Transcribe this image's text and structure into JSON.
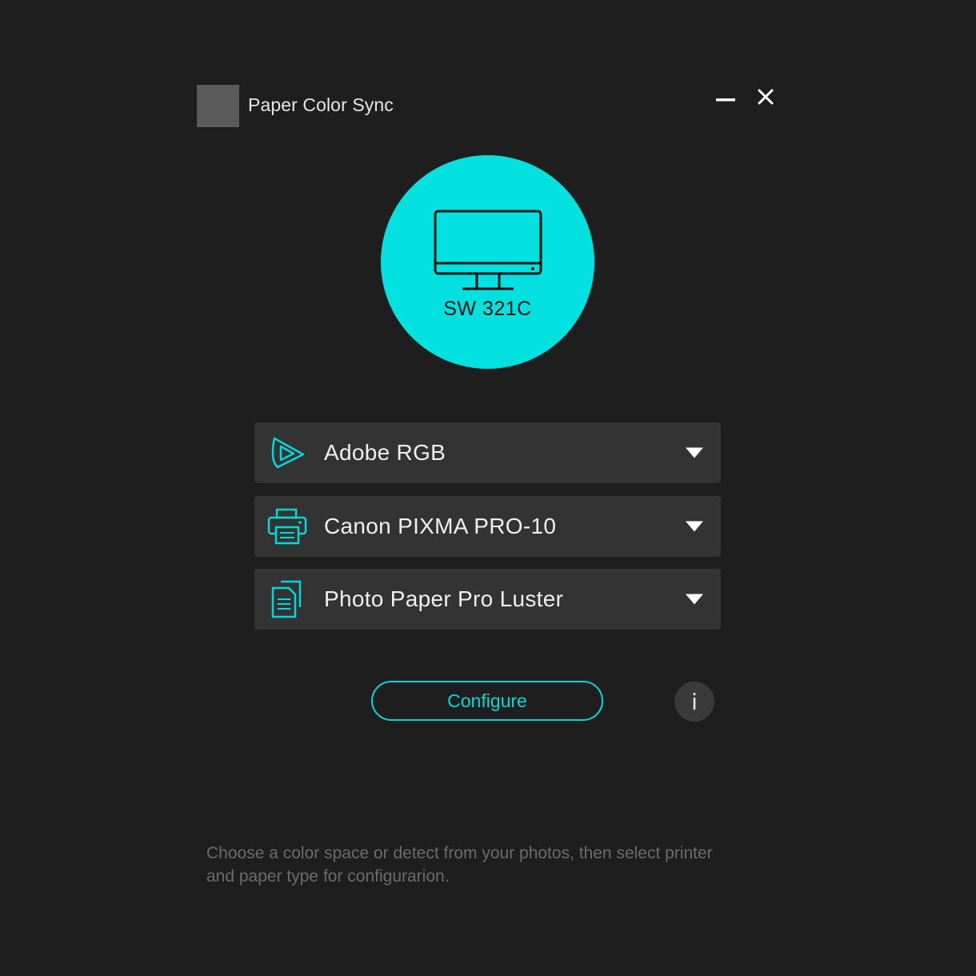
{
  "window": {
    "title": "Paper Color Sync",
    "app_icon": "app-logo-placeholder",
    "minimize_icon": "minimize-icon",
    "close_icon": "close-icon"
  },
  "device": {
    "name": "SW 321C",
    "icon": "monitor-icon",
    "circle_color": "#03e0e0"
  },
  "dropdowns": {
    "color_space": {
      "label": "Adobe RGB",
      "icon": "color-space-play-icon"
    },
    "printer": {
      "label": "Canon PIXMA PRO-10",
      "icon": "printer-icon"
    },
    "paper": {
      "label": "Photo Paper Pro Luster",
      "icon": "paper-documents-icon"
    }
  },
  "actions": {
    "configure_label": "Configure",
    "info_label": "i"
  },
  "hint": "Choose a color space or detect from your photos, then select printer and paper type for configurarion.",
  "colors": {
    "accent": "#03d8d8",
    "background": "#1e1e1e",
    "dropdown_bg": "#333333"
  }
}
